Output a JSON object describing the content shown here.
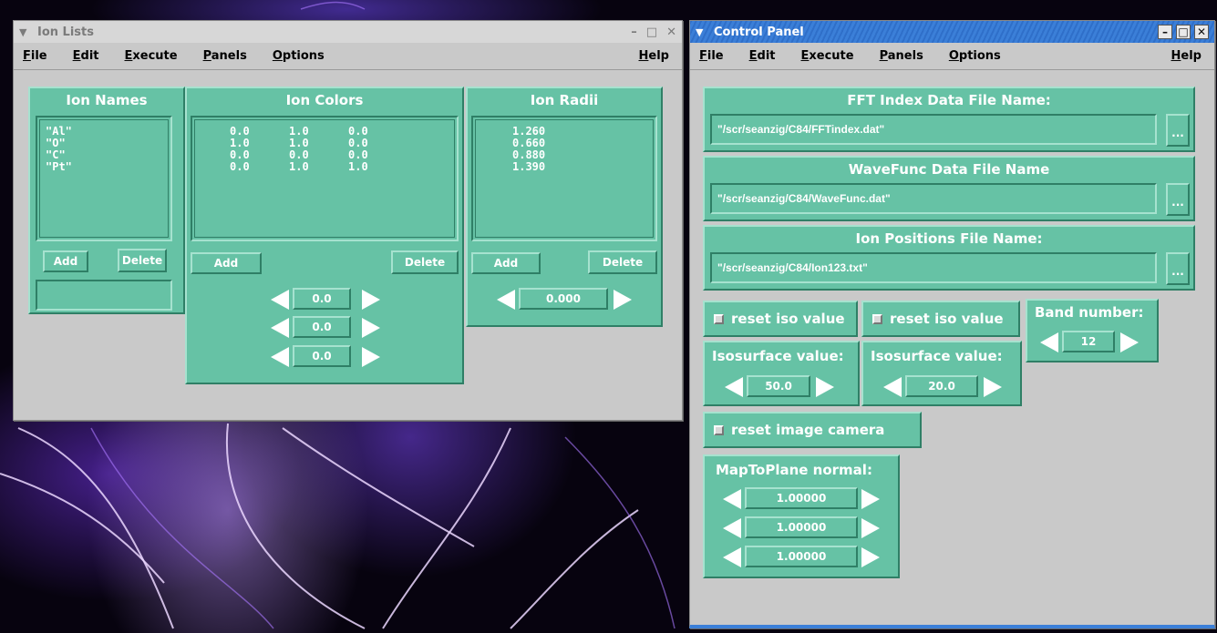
{
  "ion_window": {
    "title": "Ion Lists",
    "menu": [
      "File",
      "Edit",
      "Execute",
      "Panels",
      "Options"
    ],
    "help": "Help",
    "names_panel": {
      "title": "Ion Names",
      "items": [
        "\"Al\"",
        "\"O\"",
        "\"C\"",
        "\"Pt\""
      ],
      "add": "Add",
      "delete": "Delete",
      "entry": ""
    },
    "colors_panel": {
      "title": "Ion Colors",
      "rows": [
        "0.0      1.0      0.0",
        "1.0      1.0      0.0",
        "0.0      0.0      0.0",
        "0.0      1.0      1.0"
      ],
      "add": "Add",
      "delete": "Delete",
      "spinners": [
        "0.0",
        "0.0",
        "0.0"
      ]
    },
    "radii_panel": {
      "title": "Ion Radii",
      "items": [
        "1.260",
        "0.660",
        "0.880",
        "1.390"
      ],
      "add": "Add",
      "delete": "Delete",
      "spinner": "0.000"
    }
  },
  "control_panel": {
    "title": "Control Panel",
    "menu": [
      "File",
      "Edit",
      "Execute",
      "Panels",
      "Options"
    ],
    "help": "Help",
    "fft": {
      "title": "FFT Index Data File Name:",
      "value": "\"/scr/seanzig/C84/FFTindex.dat\"",
      "browse": "..."
    },
    "wave": {
      "title": "WaveFunc Data File Name",
      "value": "\"/scr/seanzig/C84/WaveFunc.dat\"",
      "browse": "..."
    },
    "ionpos": {
      "title": "Ion Positions File Name:",
      "value": "\"/scr/seanzig/C84/Ion123.txt\"",
      "browse": "..."
    },
    "reset_iso_1": "reset iso value",
    "reset_iso_2": "reset iso value",
    "band": {
      "title": "Band number:",
      "value": "12"
    },
    "iso1": {
      "title": "Isosurface value:",
      "value": "50.0"
    },
    "iso2": {
      "title": "Isosurface value:",
      "value": "20.0"
    },
    "reset_camera": "reset image camera",
    "map": {
      "title": "MapToPlane normal:",
      "values": [
        "1.00000",
        "1.00000",
        "1.00000"
      ]
    }
  },
  "colors": {
    "panel": "#66c2a5",
    "window": "#c9c9c9",
    "titlebar_active": "#3b7fd8"
  }
}
